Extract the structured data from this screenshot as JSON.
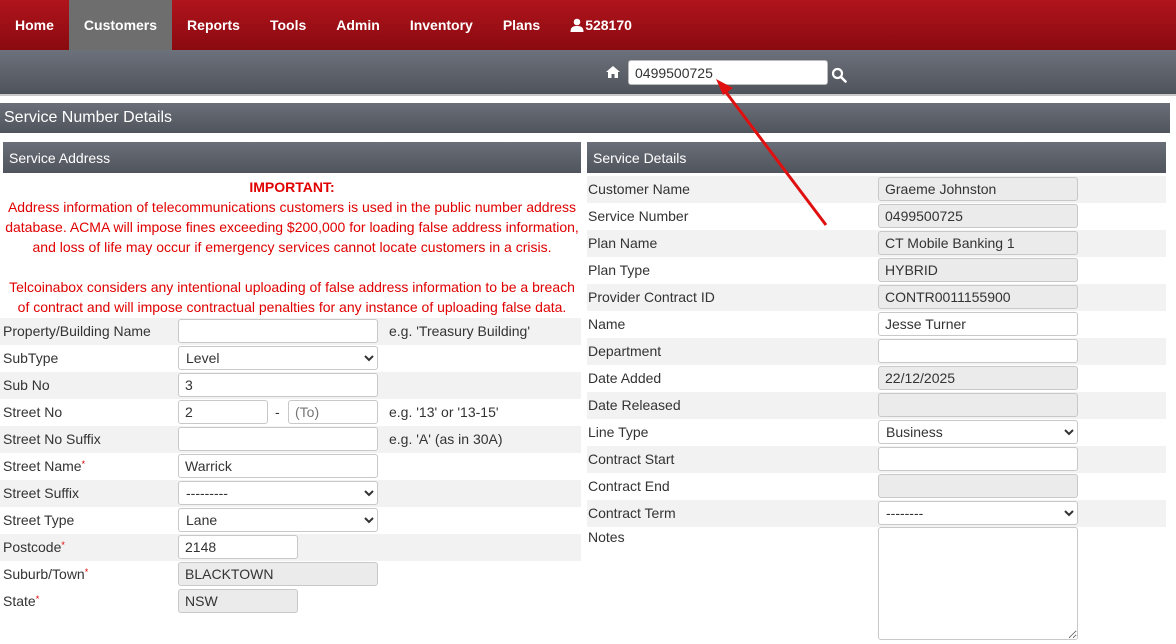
{
  "nav": {
    "items": [
      {
        "label": "Home"
      },
      {
        "label": "Customers"
      },
      {
        "label": "Reports"
      },
      {
        "label": "Tools"
      },
      {
        "label": "Admin"
      },
      {
        "label": "Inventory"
      },
      {
        "label": "Plans"
      }
    ],
    "user_label": "528170",
    "active_index": 1
  },
  "search": {
    "value": "0499500725"
  },
  "page": {
    "title": "Service Number Details"
  },
  "service_address": {
    "header": "Service Address",
    "important_title": "IMPORTANT:",
    "important_text_1": "Address information of telecommunications customers is used in the public number address database. ACMA will impose fines exceeding $200,000 for loading false address information, and loss of life may occur if emergency services cannot locate customers in a crisis.",
    "important_text_2": "Telcoinabox considers any intentional uploading of false address information to be a breach of contract and will impose contractual penalties for any instance of uploading false data.",
    "fields": {
      "property_name": {
        "label": "Property/Building Name",
        "value": "",
        "hint": "e.g. 'Treasury Building'"
      },
      "subtype": {
        "label": "SubType",
        "value": "Level"
      },
      "sub_no": {
        "label": "Sub No",
        "value": "3"
      },
      "street_no": {
        "label": "Street No",
        "value": "2",
        "to_placeholder": "(To)",
        "separator": "-",
        "hint": "e.g. '13' or '13-15'"
      },
      "street_no_suffix": {
        "label": "Street No Suffix",
        "value": "",
        "hint": "e.g. 'A' (as in 30A)"
      },
      "street_name": {
        "label": "Street Name",
        "value": "Warrick"
      },
      "street_suffix": {
        "label": "Street Suffix",
        "value": "---------"
      },
      "street_type": {
        "label": "Street Type",
        "value": "Lane"
      },
      "postcode": {
        "label": "Postcode",
        "value": "2148"
      },
      "suburb": {
        "label": "Suburb/Town",
        "value": "BLACKTOWN"
      },
      "state": {
        "label": "State",
        "value": "NSW"
      }
    },
    "required_marker": "*"
  },
  "service_details": {
    "header": "Service Details",
    "fields": {
      "customer_name": {
        "label": "Customer Name",
        "value": "Graeme Johnston"
      },
      "service_number": {
        "label": "Service Number",
        "value": "0499500725"
      },
      "plan_name": {
        "label": "Plan Name",
        "value": "CT Mobile Banking 1"
      },
      "plan_type": {
        "label": "Plan Type",
        "value": "HYBRID"
      },
      "provider_contract_id": {
        "label": "Provider Contract ID",
        "value": "CONTR0011155900"
      },
      "name": {
        "label": "Name",
        "value": "Jesse Turner"
      },
      "department": {
        "label": "Department",
        "value": ""
      },
      "date_added": {
        "label": "Date Added",
        "value": "22/12/2025"
      },
      "date_released": {
        "label": "Date Released",
        "value": ""
      },
      "line_type": {
        "label": "Line Type",
        "value": "Business"
      },
      "contract_start": {
        "label": "Contract Start",
        "value": ""
      },
      "contract_end": {
        "label": "Contract End",
        "value": ""
      },
      "contract_term": {
        "label": "Contract Term",
        "value": "--------"
      },
      "notes": {
        "label": "Notes",
        "value": ""
      }
    }
  },
  "colors": {
    "nav": "#a1121a",
    "header": "#5d616a",
    "important": "#e00000",
    "arrow": "#e01010"
  },
  "icons": [
    "home-icon",
    "search-icon",
    "user-icon"
  ]
}
